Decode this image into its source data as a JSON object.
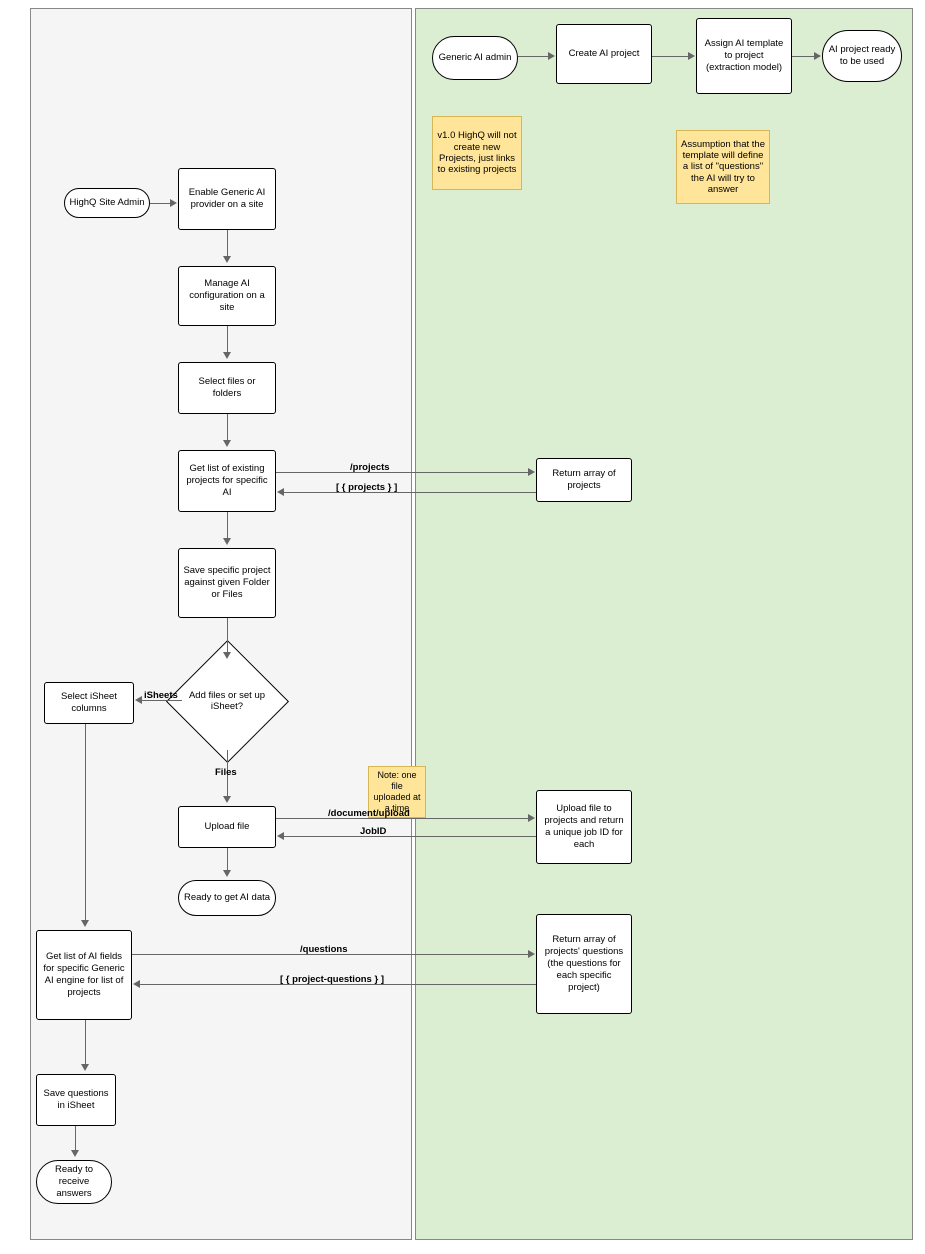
{
  "left": {
    "start": "HighQ Site Admin",
    "enable": "Enable Generic AI provider on a site",
    "manage": "Manage AI configuration on a site",
    "select_files": "Select files or folders",
    "get_projects": "Get list of existing projects for specific AI",
    "save_project": "Save specific project against given Folder or Files",
    "decision": "Add files or set up iSheet?",
    "decision_isheet": "iSheets",
    "decision_files": "Files",
    "select_isheet": "Select iSheet columns",
    "upload_file": "Upload file",
    "ready_ai": "Ready to get AI data",
    "get_fields": "Get list of AI fields for specific Generic AI engine for list of projects",
    "save_questions": "Save questions in iSheet",
    "ready_answers": "Ready to receive answers"
  },
  "right": {
    "start": "Generic AI admin",
    "create_project": "Create AI project",
    "assign_template": "Assign AI template to project (extraction model)",
    "ai_ready": "AI project ready to be used",
    "return_projects": "Return array of projects",
    "upload_job": "Upload file to projects and return a unique job ID for each",
    "return_questions": "Return array of projects' questions\n(the questions for each specific project)"
  },
  "notes": {
    "v1": "v1.0\nHighQ will not create new Projects, just links to existing projects",
    "assumption": "Assumption that the template will define a list of \"questions\" the AI will try to answer",
    "one_file": "Note: one file uploaded at a time"
  },
  "edge_labels": {
    "projects_req": "/projects",
    "projects_resp": "[ { projects } ]",
    "upload_req": "/document/upload",
    "upload_resp": "JobID",
    "questions_req": "/questions",
    "questions_resp": "[ { project-questions } ]"
  }
}
